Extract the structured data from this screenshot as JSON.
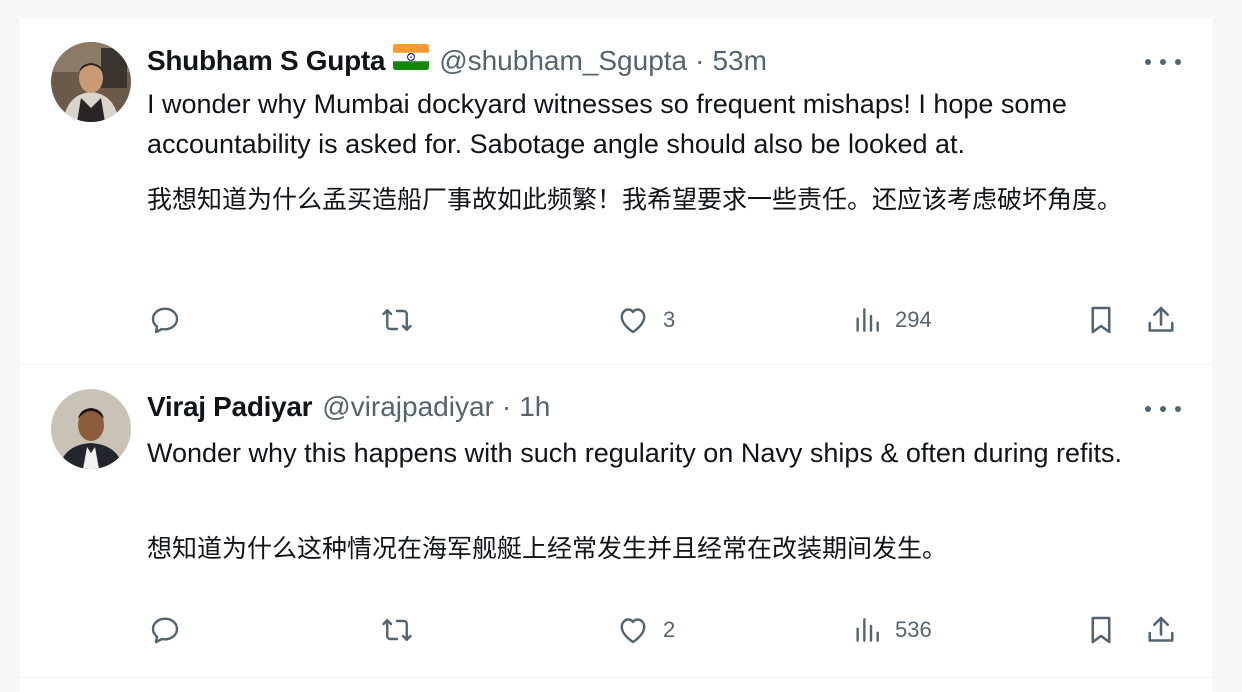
{
  "tweets": [
    {
      "name": "Shubham S Gupta",
      "flag_icon": "india-flag-icon",
      "handle": "@shubham_Sgupta",
      "time": "53m",
      "text": "I wonder why Mumbai dockyard witnesses so frequent mishaps! I hope some accountability is asked for. Sabotage angle should also be looked at.",
      "translation": "我想知道为什么孟买造船厂事故如此频繁！我希望要求一些责任。还应该考虑破坏角度。",
      "likes": "3",
      "views": "294"
    },
    {
      "name": "Viraj Padiyar",
      "handle": "@virajpadiyar",
      "time": "1h",
      "text": "Wonder why this happens with such regularity on Navy ships & often during refits.",
      "translation": "想知道为什么这种情况在海军舰艇上经常发生并且经常在改装期间发生。",
      "likes": "2",
      "views": "536"
    }
  ],
  "colors": {
    "text": "#0f1419",
    "secondary": "#536471",
    "border": "#eff3f4"
  }
}
